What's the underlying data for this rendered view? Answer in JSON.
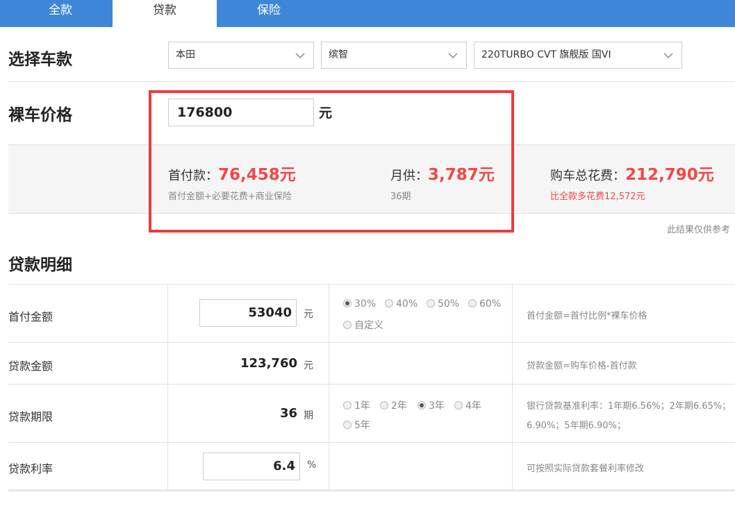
{
  "tabs": [
    {
      "label": "全款"
    },
    {
      "label": "贷款"
    },
    {
      "label": "保险"
    }
  ],
  "select_section": {
    "title": "选择车款",
    "brand": "本田",
    "model": "缤智",
    "trim": "220TURBO CVT 旗舰版 国VI"
  },
  "price_section": {
    "title": "裸车价格",
    "price_value": "176800",
    "unit": "元"
  },
  "results": {
    "down_payment_label": "首付款：",
    "down_payment_value": "76,458元",
    "down_payment_sub": "首付金额+必要花费+商业保险",
    "monthly_label": "月供：",
    "monthly_value": "3,787元",
    "monthly_sub": "36期",
    "total_label": "购车总花费：",
    "total_value": "212,790元",
    "total_sub": "比全款多花费12,572元",
    "disclaimer": "此结果仅供参考"
  },
  "loan_detail": {
    "title": "贷款明细",
    "rows": [
      {
        "label": "首付金额",
        "value": "53040",
        "unit": "元",
        "options": [
          "30%",
          "40%",
          "50%",
          "60%",
          "自定义"
        ],
        "selected": "30%",
        "hint": "首付金额=首付比例*裸车价格"
      },
      {
        "label": "贷款金额",
        "value": "123,760",
        "unit": "元",
        "hint": "贷款金额=购车价格-首付款"
      },
      {
        "label": "贷款期限",
        "value": "36",
        "unit": "期",
        "options": [
          "1年",
          "2年",
          "3年",
          "4年",
          "5年"
        ],
        "selected": "3年",
        "hint_line1": "银行贷款基准利率：1年期6.56%；2年期6.65%；",
        "hint_line2": "6.90%；5年期6.90%；"
      },
      {
        "label": "贷款利率",
        "value": "6.4",
        "unit": "%",
        "hint": "可按照实际贷款套餐利率修改"
      }
    ]
  }
}
